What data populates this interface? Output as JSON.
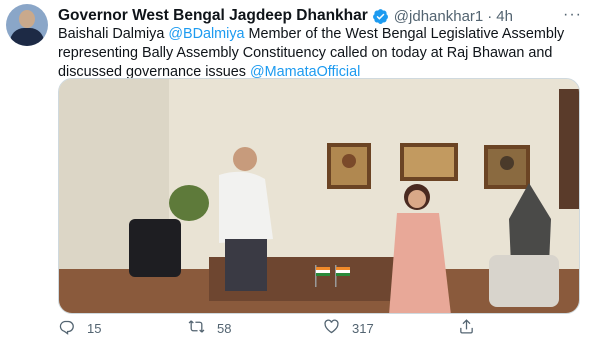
{
  "tweet": {
    "display_name": "Governor West Bengal Jagdeep Dhankhar",
    "handle": "@jdhankhar1",
    "separator": "·",
    "time": "4h",
    "more": "···",
    "text": {
      "part1": "Baishali Dalmiya ",
      "mention1": "@BDalmiya",
      "part2": " Member of the West Bengal Legislative Assembly representing Bally Assembly Constituency called on today at Raj Bhawan and discussed governance issues ",
      "mention2": "@MamataOfficial"
    },
    "actions": {
      "reply_count": "15",
      "retweet_count": "58",
      "like_count": "317"
    },
    "icons": {
      "verified": "verified-badge-icon",
      "reply": "reply-icon",
      "retweet": "retweet-icon",
      "like": "heart-icon",
      "share": "share-icon"
    },
    "colors": {
      "link": "#1d9bf0",
      "secondary_text": "#536471",
      "primary_text": "#0f1419"
    }
  }
}
